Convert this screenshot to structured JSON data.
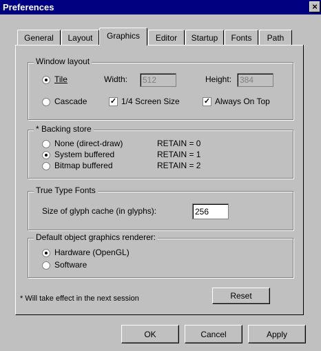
{
  "window": {
    "title": "Preferences",
    "close_label": "×"
  },
  "tabs": [
    {
      "label": "General"
    },
    {
      "label": "Layout"
    },
    {
      "label": "Graphics",
      "active": true
    },
    {
      "label": "Editor"
    },
    {
      "label": "Startup"
    },
    {
      "label": "Fonts"
    },
    {
      "label": "Path"
    }
  ],
  "window_layout": {
    "legend": "Window layout",
    "tile_label": "Tile",
    "cascade_label": "Cascade",
    "width_label": "Width:",
    "width_value": "512",
    "height_label": "Height:",
    "height_value": "384",
    "quarter_screen_label": "1/4 Screen Size",
    "always_on_top_label": "Always On Top",
    "selected": "Tile",
    "quarter_screen_checked": true,
    "always_on_top_checked": true
  },
  "backing_store": {
    "legend": "* Backing store",
    "options": [
      {
        "label": "None (direct-draw)",
        "retain": "RETAIN = 0"
      },
      {
        "label": "System buffered",
        "retain": "RETAIN = 1"
      },
      {
        "label": "Bitmap buffered",
        "retain": "RETAIN = 2"
      }
    ],
    "selected": "System buffered"
  },
  "true_type": {
    "legend": "True Type Fonts",
    "cache_label": "Size of glyph cache (in glyphs):",
    "cache_value": "256"
  },
  "renderer": {
    "legend": "Default object graphics renderer:",
    "options": [
      {
        "label": "Hardware (OpenGL)"
      },
      {
        "label": "Software"
      }
    ],
    "selected": "Hardware (OpenGL)"
  },
  "footnote": "* Will take effect in the next session",
  "buttons": {
    "reset": "Reset",
    "ok": "OK",
    "cancel": "Cancel",
    "apply": "Apply"
  }
}
